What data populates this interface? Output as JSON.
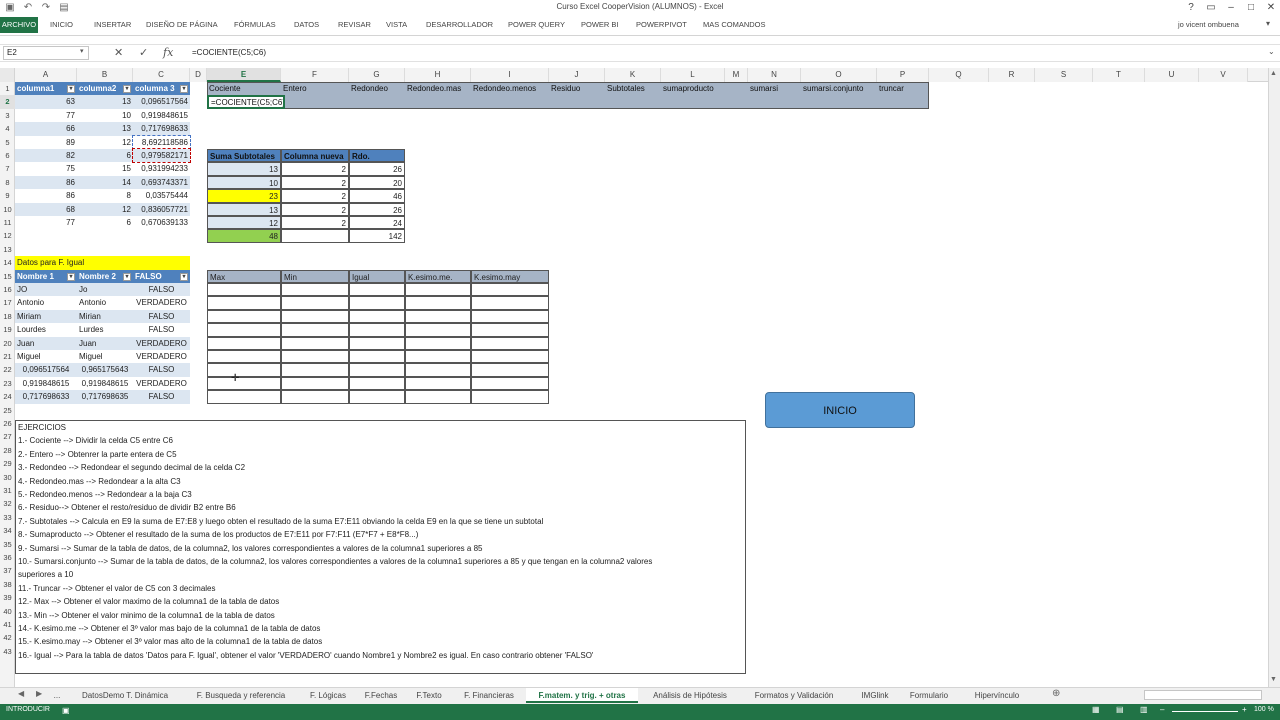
{
  "window": {
    "title": "Curso Excel CooperVision (ALUMNOS) - Excel",
    "user": "jo vicent ombuena"
  },
  "ribbon": {
    "file": "ARCHIVO",
    "tabs": [
      "INICIO",
      "INSERTAR",
      "DISEÑO DE PÁGINA",
      "FÓRMULAS",
      "DATOS",
      "REVISAR",
      "VISTA",
      "DESARROLLADOR",
      "POWER QUERY",
      "POWER BI",
      "POWERPIVOT",
      "MAS COMANDOS"
    ]
  },
  "formula_bar": {
    "name_box": "E2",
    "formula": "=COCIENTE(C5;C6)"
  },
  "columns": [
    "A",
    "B",
    "C",
    "D",
    "E",
    "F",
    "G",
    "H",
    "I",
    "J",
    "K",
    "L",
    "M",
    "N",
    "O",
    "P",
    "Q",
    "R",
    "S",
    "T",
    "U",
    "V"
  ],
  "rows": [
    "1",
    "2",
    "3",
    "4",
    "5",
    "6",
    "7",
    "8",
    "9",
    "10",
    "11",
    "12",
    "13",
    "14",
    "15",
    "16",
    "17",
    "18",
    "19",
    "20",
    "21",
    "22",
    "23",
    "24",
    "25",
    "26",
    "27",
    "28",
    "29",
    "30",
    "31",
    "32",
    "33",
    "34",
    "35",
    "36",
    "37",
    "38",
    "39",
    "40",
    "41",
    "42",
    "43"
  ],
  "main_table": {
    "headers": [
      "columna1",
      "columna2",
      "columna 3"
    ],
    "rows": [
      [
        "63",
        "13",
        "0,096517564"
      ],
      [
        "77",
        "10",
        "0,919848615"
      ],
      [
        "66",
        "13",
        "0,717698633"
      ],
      [
        "89",
        "12",
        "8,692118586"
      ],
      [
        "82",
        "6",
        "0,979582171"
      ],
      [
        "75",
        "15",
        "0,931994233"
      ],
      [
        "86",
        "14",
        "0,693743371"
      ],
      [
        "86",
        "8",
        "0,03575444"
      ],
      [
        "68",
        "12",
        "0,836057721"
      ],
      [
        "77",
        "6",
        "0,670639133"
      ]
    ]
  },
  "func_table": {
    "headers": [
      "Cociente",
      "Entero",
      "Redondeo",
      "Redondeo.mas",
      "Redondeo.menos",
      "Residuo",
      "Subtotales",
      "sumaproducto",
      "sumarsi",
      "sumarsi.conjunto",
      "truncar"
    ],
    "editing": "=COCIENTE(C5;C6)"
  },
  "subtotal_table": {
    "headers": [
      "Suma Subtotales",
      "Columna nueva",
      "Rdo."
    ],
    "rows": [
      [
        "13",
        "2",
        "26"
      ],
      [
        "10",
        "2",
        "20"
      ],
      [
        "23",
        "2",
        "46"
      ],
      [
        "13",
        "2",
        "26"
      ],
      [
        "12",
        "2",
        "24"
      ]
    ],
    "total": [
      "48",
      "",
      "142"
    ]
  },
  "igual_title": "Datos para F. Igual",
  "igual_table": {
    "headers": [
      "Nombre 1",
      "Nombre 2",
      "FALSO"
    ],
    "rows": [
      [
        "JO",
        "Jo",
        "FALSO"
      ],
      [
        "Antonio",
        "Antonio",
        "VERDADERO"
      ],
      [
        "Miriam",
        "Mirian",
        "FALSO"
      ],
      [
        "Lourdes",
        "Lurdes",
        "FALSO"
      ],
      [
        "Juan",
        "Juan",
        "VERDADERO"
      ],
      [
        "Miguel",
        "Miguel",
        "VERDADERO"
      ],
      [
        "0,096517564",
        "0,965175643",
        "FALSO"
      ],
      [
        "0,919848615",
        "0,919848615",
        "VERDADERO"
      ],
      [
        "0,717698633",
        "0,717698635",
        "FALSO"
      ]
    ]
  },
  "stats_table": {
    "headers": [
      "Max",
      "Min",
      "Igual",
      "K.esimo.me.",
      "K.esimo.may"
    ]
  },
  "exercises": [
    "EJERCICIOS",
    "1.- Cociente --> Dividir la celda C5 entre C6",
    "2.- Entero --> Obtenrer la parte entera de C5",
    "3.- Redondeo --> Redondear el segundo decimal de la celda C2",
    "4.- Redondeo.mas --> Redondear a la alta C3",
    "5.- Redondeo.menos --> Redondear a la baja C3",
    "6.- Residuo--> Obtener el resto/residuo de dividir B2 entre B6",
    "7.- Subtotales --> Calcula en E9 la suma de E7:E8 y luego obten el resultado de la suma E7:E11 obviando la celda E9 en la que se tiene un subtotal",
    "8.- Sumaproducto --> Obtener el resultado de la suma de los productos de E7:E11 por F7:F11 (E7*F7 + E8*F8...)",
    "9.- Sumarsi --> Sumar de la tabla de datos, de la columna2, los valores correspondientes a valores de la columna1 superiores a 85",
    "10.- Sumarsi.conjunto --> Sumar de la tabla de datos, de la columna2, los valores correspondientes a valores de la columna1 superiores a 85 y que tengan en la columna2 valores",
    "superiores a 10",
    "11.- Truncar --> Obtener el valor de C5 con 3 decimales",
    "12.- Max --> Obtener el valor maximo de la columna1 de la tabla de datos",
    "13.- Min --> Obtener el valor minimo de la columna1 de la tabla de datos",
    "14.- K.esimo.me --> Obtener el 3º valor mas bajo de la columna1 de la tabla de datos",
    "15.- K.esimo.may --> Obtener el 3º valor mas alto de la columna1 de la tabla de datos",
    "16.- Igual --> Para la tabla de datos 'Datos para F. Igual', obtener el valor 'VERDADERO' cuando Nombre1 y Nombre2 es igual. En caso contrario obtener 'FALSO'"
  ],
  "button": {
    "label": "INICIO"
  },
  "sheet_tabs": {
    "ellipsis": "...",
    "tabs": [
      "DatosDemo T. Dinámica",
      "F. Busqueda y referencia",
      "F. Lógicas",
      "F.Fechas",
      "F.Texto",
      "F. Financieras",
      "F.matem. y trig. + otras",
      "Análisis de Hipótesis",
      "Formatos y Validación",
      "IMGlink",
      "Formulario",
      "Hipervínculo"
    ],
    "active": "F.matem. y trig. + otras"
  },
  "status": {
    "mode": "INTRODUCIR",
    "zoom": "100 %"
  },
  "colors": {
    "excel_green": "#217346",
    "header_blue": "#4f81bd",
    "band": "#dce6f1",
    "highlight_yellow": "#ffff00",
    "total_green": "#92d050",
    "button": "#5b9bd5"
  }
}
